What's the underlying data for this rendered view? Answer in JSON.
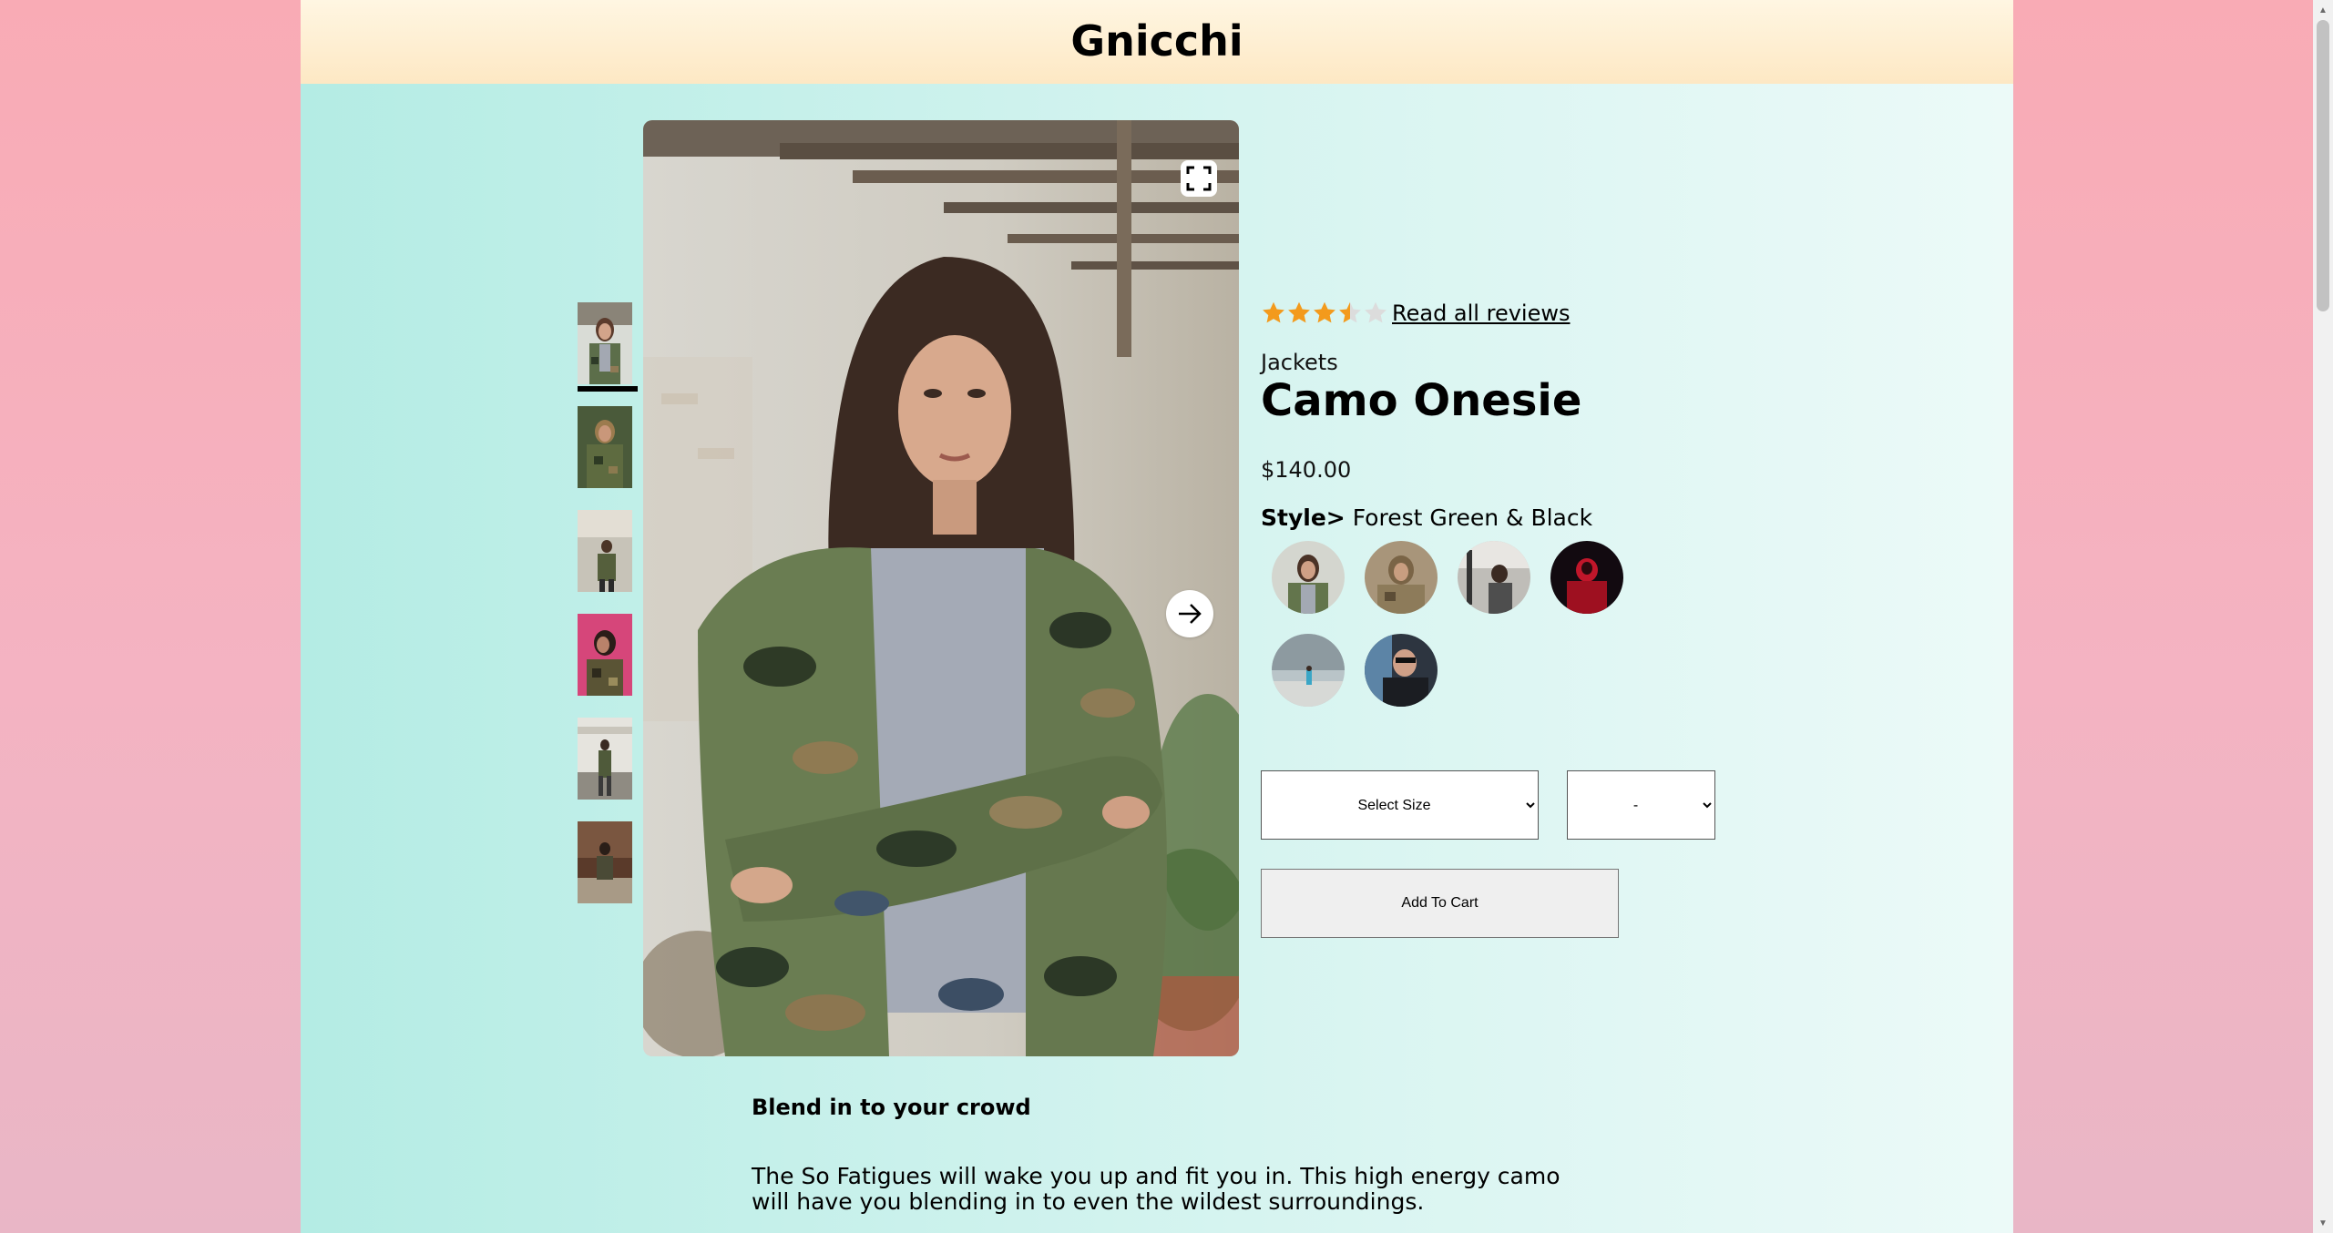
{
  "site": {
    "title": "Gnicchi"
  },
  "gallery": {
    "thumbnails": [
      "camo-jacket-front",
      "camo-jacket-side",
      "camo-jacket-street",
      "camo-jacket-pink-wall",
      "camo-jacket-full-body",
      "camo-jacket-bench"
    ],
    "active_index": 0,
    "main_image": "woman-in-camo-jacket",
    "fullscreen_icon": "fullscreen-icon",
    "next_icon": "arrow-right-icon"
  },
  "product": {
    "rating": 3.5,
    "rating_max": 5,
    "reviews_link": "Read all reviews",
    "category": "Jackets",
    "name": "Camo Onesie",
    "price": "$140.00",
    "style_label": "Style>",
    "style_value": "Forest Green & Black",
    "swatches": [
      "camo-jacket",
      "tan-camo",
      "urban-grey",
      "red-black",
      "sky-blue",
      "black-glasses"
    ]
  },
  "form": {
    "size_select": "Select Size",
    "qty_select": "-",
    "add_to_cart": "Add To Cart"
  },
  "description": {
    "heading": "Blend in to your crowd",
    "body": "The So Fatigues will wake you up and fit you in. This high energy camo will have you blending in to even the wildest surroundings."
  },
  "colors": {
    "star": "#f39a1c",
    "star_empty": "#dcdcdc"
  }
}
